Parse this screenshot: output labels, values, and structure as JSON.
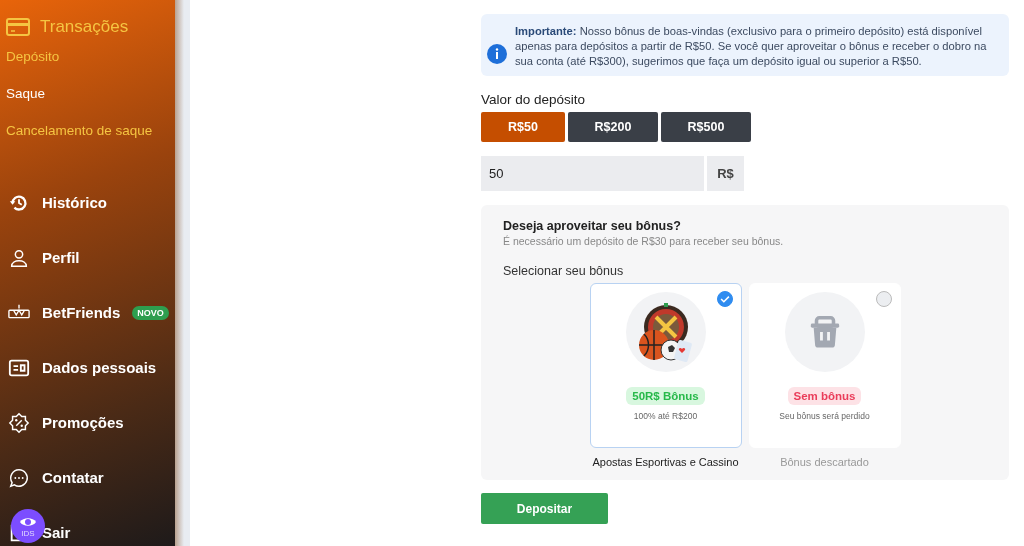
{
  "sidebar": {
    "section": {
      "title": "Transações",
      "items": [
        {
          "label": "Depósito",
          "color": "#f5c542"
        },
        {
          "label": "Saque",
          "color": "#ffffff"
        },
        {
          "label": "Cancelamento de saque",
          "color": "#f5c542"
        }
      ]
    },
    "menu": [
      {
        "label": "Histórico"
      },
      {
        "label": "Perfil"
      },
      {
        "label": "BetFriends",
        "badge": "NOVO"
      },
      {
        "label": "Dados pessoais"
      },
      {
        "label": "Promoções"
      },
      {
        "label": "Contatar"
      },
      {
        "label": "Sair"
      }
    ],
    "floating_button": {
      "label": "IDS"
    }
  },
  "notice": {
    "text": "**Importante:** Nosso bônus de boas-vindas (exclusivo para o primeiro depósito) está disponível apenas para depósitos a partir de R$50. Se você quer aproveitar o bônus e receber o dobro na sua conta (até R$300), sugerimos que faça um depósito igual ou superior a R$50."
  },
  "deposit": {
    "label": "Valor do depósito",
    "amounts": [
      {
        "label": "R$50",
        "selected": true
      },
      {
        "label": "R$200",
        "selected": false
      },
      {
        "label": "R$500",
        "selected": false
      }
    ],
    "value": "50",
    "currency": "R$"
  },
  "bonus": {
    "title": "Deseja aproveitar seu bônus?",
    "subtitle": "É necessário um depósito de R$30 para receber seu bônus.",
    "select_label": "Selecionar seu bônus",
    "options": [
      {
        "kind": "bonus",
        "tag": "50R$ Bônus",
        "description": "100% até R$200",
        "caption": "Apostas Esportivas e Cassino",
        "selected": true
      },
      {
        "kind": "none",
        "tag": "Sem bônus",
        "description": "Seu bônus será perdido",
        "caption": "Bônus descartado",
        "selected": false
      }
    ]
  },
  "submit": "Depositar"
}
